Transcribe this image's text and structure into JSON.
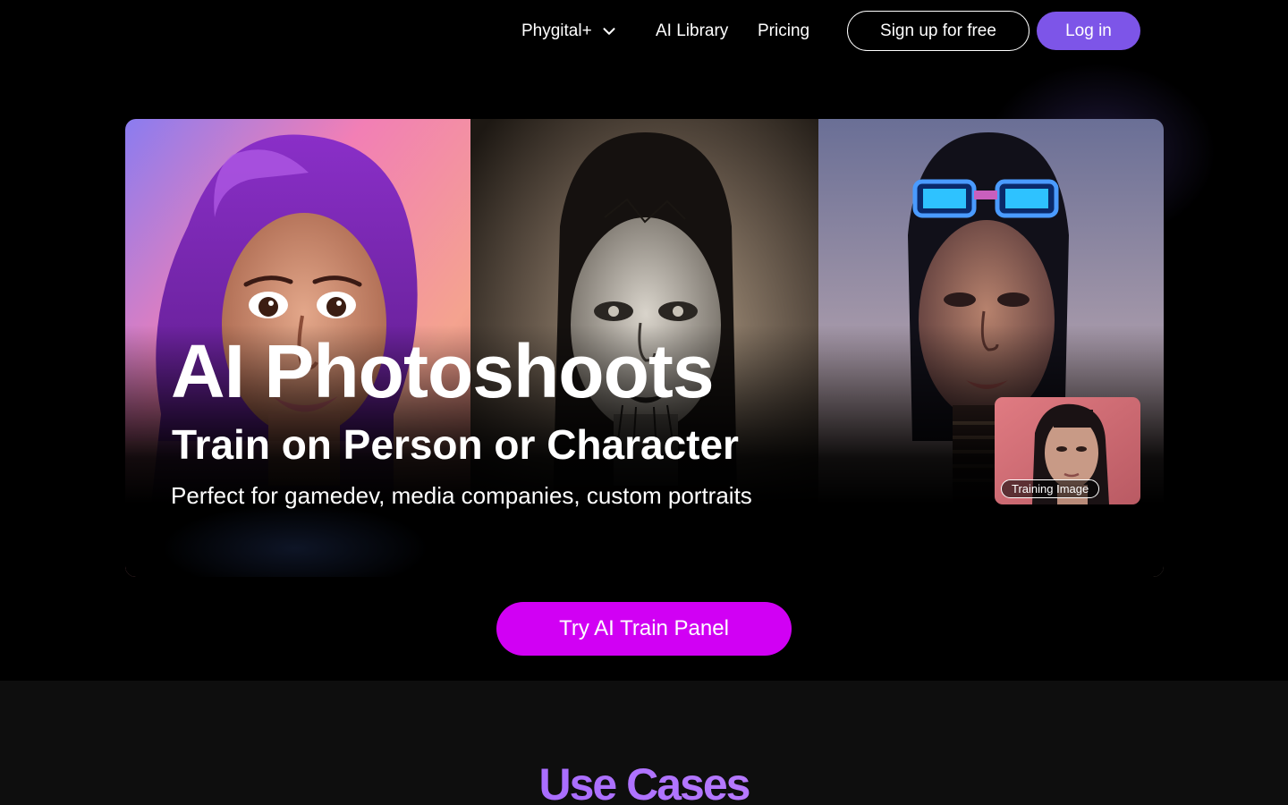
{
  "nav": {
    "product_label": "Phygital+",
    "product_icon": "chevron-down-icon",
    "library_label": "AI Library",
    "pricing_label": "Pricing",
    "signup_label": "Sign up for free",
    "login_label": "Log in"
  },
  "hero": {
    "title": "AI Photoshoots",
    "subtitle": "Train on Person or Character",
    "description": "Perfect for gamedev, media companies, custom portraits",
    "training_badge": "Training Image"
  },
  "cta": {
    "label": "Try AI Train Panel"
  },
  "use_cases": {
    "title": "Use Cases"
  },
  "colors": {
    "login_bg": "#7d55e8",
    "cta_bg": "#d100f4",
    "use_cases_gradient_start": "#7f5cff",
    "use_cases_gradient_end": "#d89aff",
    "section_bg": "#0e0e0e"
  }
}
